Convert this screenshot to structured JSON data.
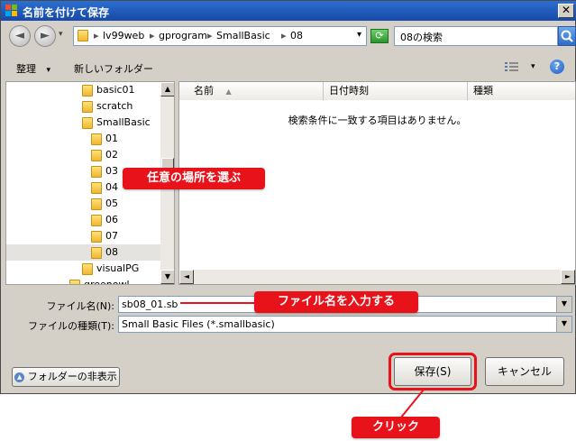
{
  "window": {
    "title": "名前を付けて保存",
    "close_glyph": "✕"
  },
  "nav": {
    "back_glyph": "◄",
    "forward_glyph": "►"
  },
  "address": {
    "breadcrumbs": [
      "lv99web",
      "gprogram",
      "SmallBasic",
      "08"
    ],
    "separator": "▸",
    "dropdown_glyph": "▾"
  },
  "search": {
    "value": "08の検索"
  },
  "toolbar": {
    "organize": "整理",
    "organize_arrow": "▾",
    "new_folder": "新しいフォルダー",
    "view_arrow": "▾",
    "help": "?"
  },
  "tree": {
    "items": [
      {
        "label": "basic01",
        "level": 1,
        "selected": false
      },
      {
        "label": "scratch",
        "level": 1,
        "selected": false
      },
      {
        "label": "SmallBasic",
        "level": 1,
        "selected": false
      },
      {
        "label": "01",
        "level": 2,
        "selected": false
      },
      {
        "label": "02",
        "level": 2,
        "selected": false
      },
      {
        "label": "03",
        "level": 2,
        "selected": false
      },
      {
        "label": "04",
        "level": 2,
        "selected": false
      },
      {
        "label": "05",
        "level": 2,
        "selected": false
      },
      {
        "label": "06",
        "level": 2,
        "selected": false
      },
      {
        "label": "07",
        "level": 2,
        "selected": false
      },
      {
        "label": "08",
        "level": 2,
        "selected": true
      },
      {
        "label": "visualPG",
        "level": 1,
        "selected": false
      },
      {
        "label": "greenowl",
        "level": 0,
        "selected": false
      }
    ]
  },
  "list": {
    "columns": [
      {
        "label": "名前",
        "sort": "▲"
      },
      {
        "label": "日付時刻"
      },
      {
        "label": "種類"
      }
    ],
    "empty_message": "検索条件に一致する項目はありません。"
  },
  "filename": {
    "label": "ファイル名(N):",
    "value": "sb08_01.sb"
  },
  "filetype": {
    "label": "ファイルの種類(T):",
    "value": "Small Basic Files (*.smallbasic)"
  },
  "buttons": {
    "hide_folders": "フォルダーの非表示",
    "save": "保存(S)",
    "cancel": "キャンセル"
  },
  "annotations": {
    "choose_location": "任意の場所を選ぶ",
    "enter_filename": "ファイル名を入力する",
    "click": "クリック"
  },
  "colors": {
    "annotation": "#e8121b",
    "titlebar": "#1d55b8"
  }
}
